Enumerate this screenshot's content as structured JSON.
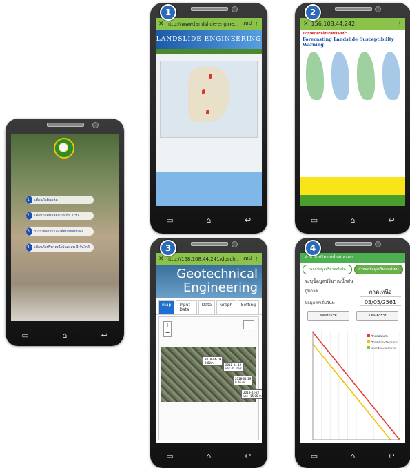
{
  "badges": [
    "1",
    "2",
    "3",
    "4"
  ],
  "phone0": {
    "menu": [
      {
        "num": "1",
        "label": "เตือนภัยดินถล่ม"
      },
      {
        "num": "2",
        "label": "เตือนภัยดินถล่มล่วงหน้า 3 วัน"
      },
      {
        "num": "3",
        "label": "ระบบติดตามและเตือนภัยดินถล่ม"
      },
      {
        "num": "4",
        "label": "เตือนภัยปริมาณน้ำฝนสะสม 3 วันใกล้"
      }
    ]
  },
  "phone1": {
    "url": "http://www.landslide-engine...",
    "tab_count": "แทป",
    "banner": "LANDSLIDE ENGINEERING"
  },
  "phone2": {
    "url": "156.108.44.242",
    "title_th": "ระบบพยากรณ์ดินถล่มล่วงหน้า",
    "title_en": "Forecasting Landslide Susceptibility Warning"
  },
  "phone3": {
    "url": "http://158.108.44.241/dosch...",
    "tab_count": "แทป",
    "logo_line1": "Geotechnical",
    "logo_line2": "Engineering",
    "tabs": [
      "map",
      "Input Data",
      "Data",
      "Graph",
      "Setting"
    ],
    "popups": [
      {
        "line1": "2018-04-19",
        "line2": "0.80m"
      },
      {
        "line1": "2018-04-19",
        "line2": "vel: -0.1m/s"
      },
      {
        "line1": "2018-04-19",
        "line2": "0.26 m"
      },
      {
        "line1": "2018-03-22",
        "line2": "vel: -15.06 m"
      }
    ]
  },
  "phone4": {
    "title": "คำนวณปริมาณน้ำฝนสะสม",
    "tabs": [
      "กรอกข้อมูลปริมาณน้ำฝน",
      "กำหนดข้อมูลปริมาณน้ำฝน"
    ],
    "form_title": "ระบุข้อมูลปริมาณน้ำฝน",
    "region_label": "ภูมิภาค",
    "region_value": "ภาคเหนือ",
    "date_label": "ข้อมูลตกเริ่มวันที่",
    "date_value": "03/05/2561",
    "btn_graph": "แสดงกราฟ",
    "btn_table": "แสดงตาราง",
    "legend": [
      "วิกฤตเตือนภัย",
      "วิกฤตเฝ้าระวังตามจาก",
      "ค่าเฉลี่ยสะสมรายวัน"
    ],
    "colors": {
      "red": "#e53935",
      "yellow": "#f2c200",
      "green": "#8bc34a"
    }
  },
  "chart_data": {
    "type": "line",
    "series": [
      {
        "name": "วิกฤตเตือนภัย",
        "x": [
          0,
          380
        ],
        "y": [
          148,
          0
        ]
      },
      {
        "name": "วิกฤตเฝ้าระวังตามจาก",
        "x": [
          0,
          340
        ],
        "y": [
          132,
          0
        ]
      }
    ],
    "xlim": [
      0,
      380
    ],
    "ylim": [
      0,
      150
    ]
  }
}
